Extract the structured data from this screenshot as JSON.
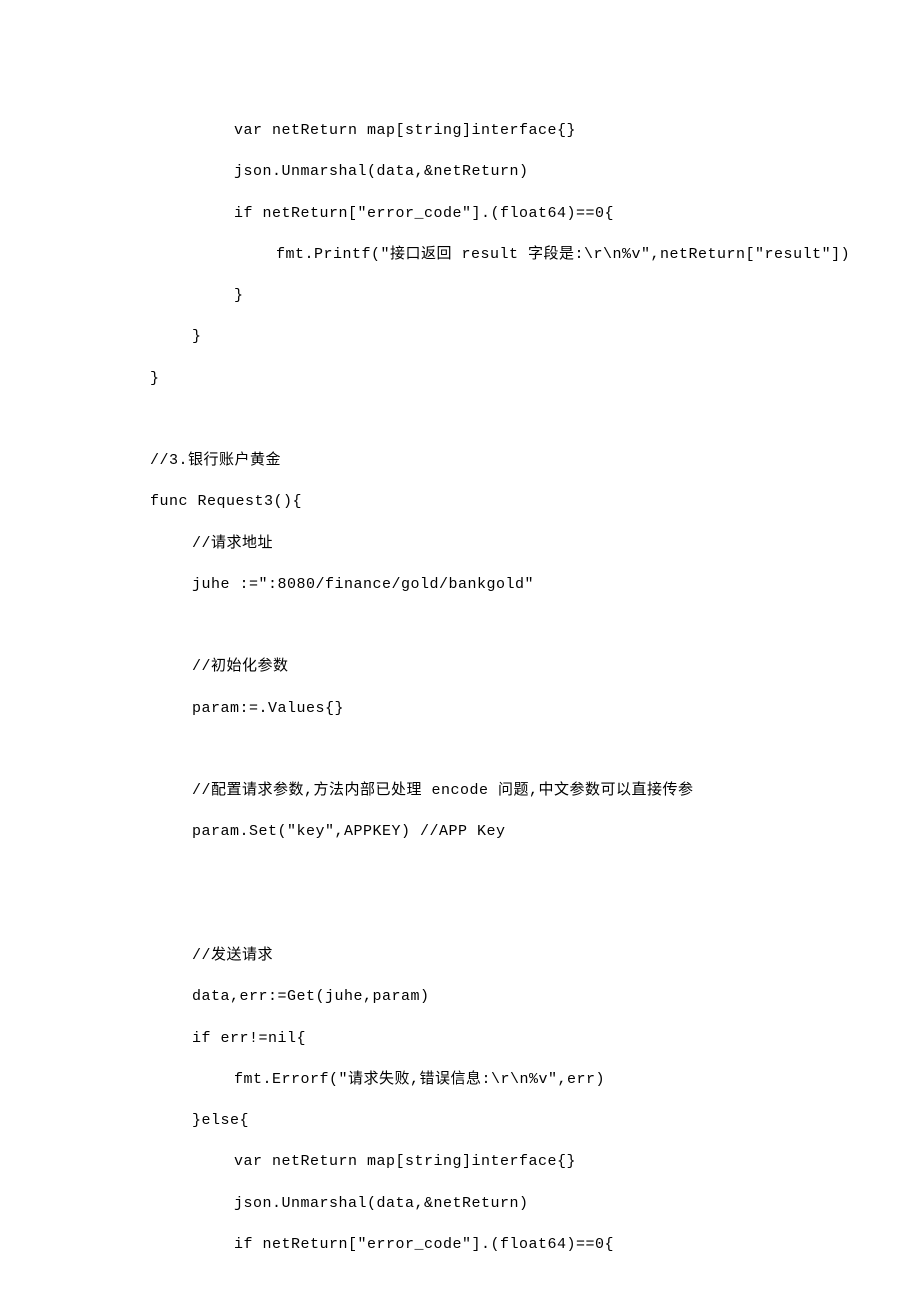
{
  "code": {
    "lines": [
      {
        "indent": 3,
        "text": "var netReturn map[string]interface{}"
      },
      {
        "indent": 3,
        "text": "json.Unmarshal(data,&netReturn)"
      },
      {
        "indent": 3,
        "text": "if netReturn[\"error_code\"].(float64)==0{"
      },
      {
        "indent": 4,
        "text": "fmt.Printf(\"接口返回 result 字段是:\\r\\n%v\",netReturn[\"result\"])"
      },
      {
        "indent": 3,
        "text": "}"
      },
      {
        "indent": 2,
        "text": "}"
      },
      {
        "indent": 1,
        "text": "}"
      },
      {
        "indent": 0,
        "text": "",
        "blank": true
      },
      {
        "indent": 1,
        "text": "//3.银行账户黄金"
      },
      {
        "indent": 1,
        "text": "func Request3(){"
      },
      {
        "indent": 2,
        "text": "//请求地址"
      },
      {
        "indent": 2,
        "text": "juhe :=\":8080/finance/gold/bankgold\""
      },
      {
        "indent": 0,
        "text": "",
        "blank": true
      },
      {
        "indent": 2,
        "text": "//初始化参数"
      },
      {
        "indent": 2,
        "text": "param:=.Values{}"
      },
      {
        "indent": 0,
        "text": "",
        "blank": true
      },
      {
        "indent": 2,
        "text": "//配置请求参数,方法内部已处理 encode 问题,中文参数可以直接传参"
      },
      {
        "indent": 2,
        "text": "param.Set(\"key\",APPKEY) //APP Key"
      },
      {
        "indent": 0,
        "text": "",
        "blank": true
      },
      {
        "indent": 0,
        "text": "",
        "blank": true
      },
      {
        "indent": 2,
        "text": "//发送请求"
      },
      {
        "indent": 2,
        "text": "data,err:=Get(juhe,param)"
      },
      {
        "indent": 2,
        "text": "if err!=nil{"
      },
      {
        "indent": 3,
        "text": "fmt.Errorf(\"请求失败,错误信息:\\r\\n%v\",err)"
      },
      {
        "indent": 2,
        "text": "}else{"
      },
      {
        "indent": 3,
        "text": "var netReturn map[string]interface{}"
      },
      {
        "indent": 3,
        "text": "json.Unmarshal(data,&netReturn)"
      },
      {
        "indent": 3,
        "text": "if netReturn[\"error_code\"].(float64)==0{"
      }
    ]
  }
}
